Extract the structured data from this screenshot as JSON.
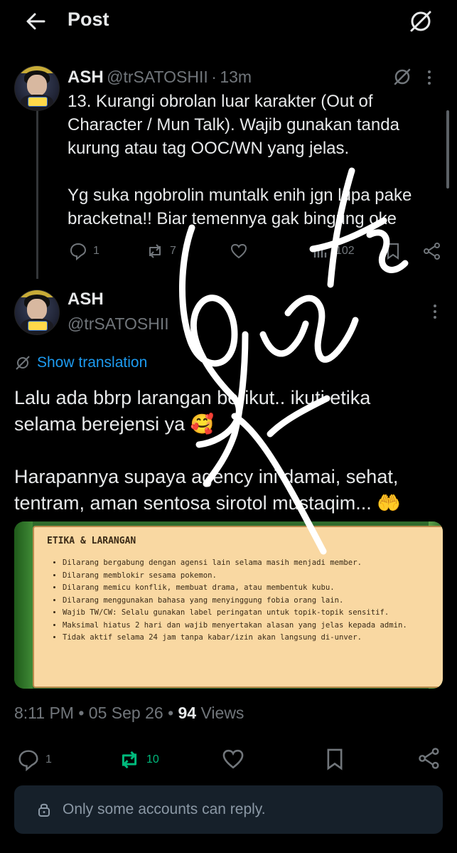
{
  "header": {
    "title": "Post"
  },
  "parent_post": {
    "name": "ASH",
    "handle": "@trSATOSHII",
    "time": "13m",
    "text": "13. Kurangi obrolan luar karakter (Out of\nCharacter / Mun Talk). Wajib gunakan tanda\nkurung atau tag OOC/WN yang jelas.\n\nYg suka ngobrolin muntalk enih jgn lupa pake\nbracketna!! Biar temennya gak bingung oke",
    "replies": "1",
    "reposts": "7",
    "views": "102"
  },
  "main_post": {
    "name": "ASH",
    "handle": "@trSATOSHII",
    "show_translation": "Show translation",
    "text": "Lalu ada bbrp larangan berikut.. ikuti etika\nselama berejensi ya 🥰\n\nHarapannya supaya agency ini damai, sehat,\ntentram, aman sentosa sirotol mustaqim... 🤲",
    "image": {
      "title": "ETIKA & LARANGAN",
      "items": [
        "Dilarang bergabung dengan agensi lain selama masih menjadi member.",
        "Dilarang memblokir sesama pokemon.",
        "Dilarang memicu konflik, membuat drama, atau membentuk kubu.",
        "Dilarang menggunakan bahasa yang menyinggung fobia orang lain.",
        "Wajib TW/CW: Selalu gunakan label peringatan untuk topik-topik sensitif.",
        "Maksimal hiatus 2 hari dan wajib menyertakan alasan yang jelas kepada admin.",
        "Tidak aktif selama 24 jam tanpa kabar/izin akan langsung di-unver."
      ]
    },
    "meta": {
      "time": "8:11 PM",
      "date": "05 Sep 26",
      "views_count": "94",
      "views_label": "Views"
    },
    "replies": "1",
    "reposts": "10"
  },
  "reply_restriction": "Only some accounts can reply.",
  "colors": {
    "accent": "#1d9bf0",
    "repost_active": "#00ba7c",
    "muted": "#71767b",
    "background": "#000000"
  },
  "icons": [
    "back-arrow-icon",
    "grok-icon",
    "reply-icon",
    "repost-icon",
    "like-icon",
    "views-icon",
    "bookmark-icon",
    "share-icon",
    "more-icon",
    "translate-icon",
    "lock-icon"
  ]
}
